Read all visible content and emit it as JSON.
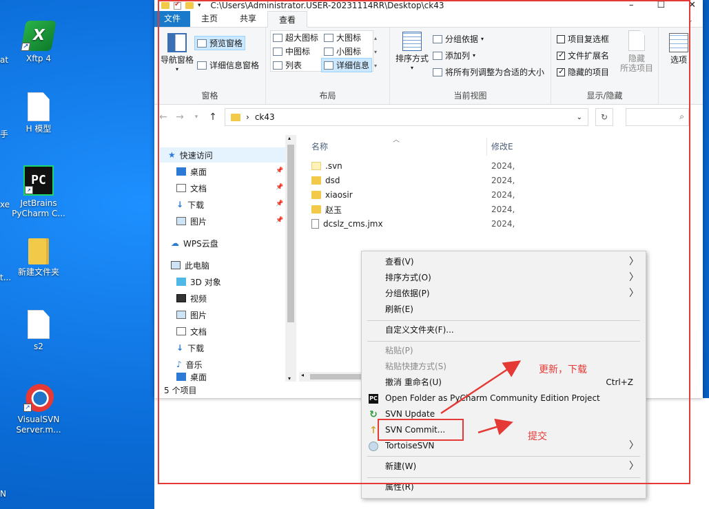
{
  "desktop": {
    "edge_labels": [
      "at",
      "手",
      "xe",
      "t...",
      "N"
    ],
    "icons": [
      {
        "label": "Xftp 4",
        "type": "xftp"
      },
      {
        "label": "H 模型",
        "type": "doc"
      },
      {
        "label": "JetBrains PyCharm C...",
        "type": "pycharm"
      },
      {
        "label": "新建文件夹",
        "type": "folder"
      },
      {
        "label": "s2",
        "type": "doc"
      },
      {
        "label": "VisualSVN Server.m...",
        "type": "svn"
      }
    ]
  },
  "explorer": {
    "title_path": "C:\\Users\\Administrator.USER-20231114RR\\Desktop\\ck43",
    "tabs": [
      "文件",
      "主页",
      "共享",
      "查看"
    ],
    "active_tab": "查看",
    "ribbon": {
      "panes_group": {
        "name": "窗格",
        "nav_pane": "导航窗格",
        "preview_pane": "预览窗格",
        "details_pane": "详细信息窗格"
      },
      "layout_group": {
        "name": "布局",
        "options": [
          "超大图标",
          "大图标",
          "中图标",
          "小图标",
          "列表",
          "详细信息"
        ],
        "selected": "详细信息"
      },
      "current_view_group": {
        "name": "当前视图",
        "sort_by": "排序方式",
        "group_by": "分组依据",
        "add_column": "添加列",
        "fit_columns": "将所有列调整为合适的大小"
      },
      "show_hide_group": {
        "name": "显示/隐藏",
        "item_checkboxes": "项目复选框",
        "file_extensions": "文件扩展名",
        "hidden_items": "隐藏的项目",
        "hide_selected": "隐藏",
        "hide_selected_line2": "所选项目",
        "options": "选项"
      }
    },
    "address": {
      "current_folder": "ck43",
      "separator": "›"
    },
    "nav_items": [
      {
        "label": "快速访问",
        "icon": "star-icon",
        "pinned": false,
        "selected": true
      },
      {
        "label": "桌面",
        "icon": "desktop-icon",
        "pinned": true
      },
      {
        "label": "文档",
        "icon": "document-icon",
        "pinned": true
      },
      {
        "label": "下载",
        "icon": "download-icon",
        "pinned": true
      },
      {
        "label": "图片",
        "icon": "picture-icon",
        "pinned": true
      },
      {
        "label": "WPS云盘",
        "icon": "cloud-icon",
        "pinned": false
      },
      {
        "label": "此电脑",
        "icon": "computer-icon",
        "pinned": false
      },
      {
        "label": "3D 对象",
        "icon": "cube-icon",
        "pinned": false
      },
      {
        "label": "视频",
        "icon": "video-icon",
        "pinned": false
      },
      {
        "label": "图片",
        "icon": "picture-icon",
        "pinned": false
      },
      {
        "label": "文档",
        "icon": "document-icon",
        "pinned": false
      },
      {
        "label": "下载",
        "icon": "download-icon",
        "pinned": false
      },
      {
        "label": "音乐",
        "icon": "music-icon",
        "pinned": false
      },
      {
        "label": "桌面",
        "icon": "desktop-icon",
        "pinned": false
      }
    ],
    "columns": {
      "name": "名称",
      "modified": "修改E"
    },
    "files": [
      {
        "name": ".svn",
        "type": "svn-folder",
        "date": "2024,"
      },
      {
        "name": "dsd",
        "type": "folder",
        "date": "2024,"
      },
      {
        "name": "xiaosir",
        "type": "folder",
        "date": "2024,"
      },
      {
        "name": "赵玉",
        "type": "folder",
        "date": "2024,"
      },
      {
        "name": "dcslz_cms.jmx",
        "type": "file",
        "date": "2024,"
      }
    ],
    "status": "5 个项目"
  },
  "context_menu": {
    "items": [
      {
        "label": "查看(V)",
        "submenu": true
      },
      {
        "label": "排序方式(O)",
        "submenu": true
      },
      {
        "label": "分组依据(P)",
        "submenu": true
      },
      {
        "label": "刷新(E)"
      },
      {
        "sep": true
      },
      {
        "label": "自定义文件夹(F)..."
      },
      {
        "sep": true
      },
      {
        "label": "粘贴(P)",
        "disabled": true
      },
      {
        "label": "粘贴快捷方式(S)",
        "disabled": true
      },
      {
        "label": "撤消 重命名(U)",
        "shortcut": "Ctrl+Z"
      },
      {
        "label": "Open Folder as PyCharm Community Edition Project",
        "icon": "pycharm-icon"
      },
      {
        "label": "SVN Update",
        "icon": "svn-update-icon"
      },
      {
        "label": "SVN Commit...",
        "icon": "svn-commit-icon"
      },
      {
        "label": "TortoiseSVN",
        "icon": "tortoise-icon",
        "submenu": true
      },
      {
        "sep": true
      },
      {
        "label": "新建(W)",
        "submenu": true
      },
      {
        "sep": true
      },
      {
        "label": "属性(R)"
      }
    ]
  },
  "annotations": {
    "update_text": "更新，下载",
    "commit_text": "提交",
    "color": "#e53935"
  }
}
